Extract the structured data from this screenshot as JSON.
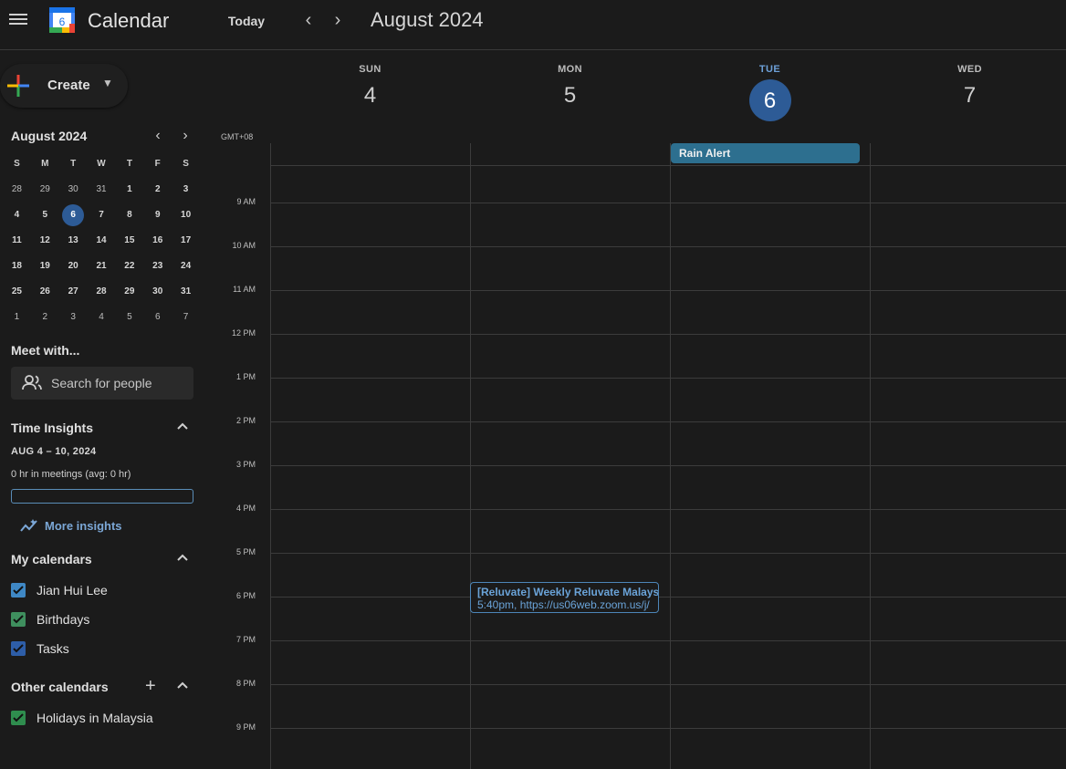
{
  "app": {
    "title": "Calendar",
    "logo_day": "6"
  },
  "header": {
    "today_label": "Today",
    "prev_icon": "chevron-left",
    "next_icon": "chevron-right",
    "month": "August 2024"
  },
  "create": {
    "label": "Create"
  },
  "mini_calendar": {
    "title": "August 2024",
    "weekdays": [
      "S",
      "M",
      "T",
      "W",
      "T",
      "F",
      "S"
    ],
    "weeks": [
      [
        "28",
        "29",
        "30",
        "31",
        "1",
        "2",
        "3"
      ],
      [
        "4",
        "5",
        "6",
        "7",
        "8",
        "9",
        "10"
      ],
      [
        "11",
        "12",
        "13",
        "14",
        "15",
        "16",
        "17"
      ],
      [
        "18",
        "19",
        "20",
        "21",
        "22",
        "23",
        "24"
      ],
      [
        "25",
        "26",
        "27",
        "28",
        "29",
        "30",
        "31"
      ],
      [
        "1",
        "2",
        "3",
        "4",
        "5",
        "6",
        "7"
      ]
    ],
    "today": "6"
  },
  "meet": {
    "title": "Meet with...",
    "placeholder": "Search for people"
  },
  "insights": {
    "title": "Time Insights",
    "range": "AUG 4 – 10, 2024",
    "meetings": "0 hr in meetings (avg: 0 hr)",
    "more": "More insights"
  },
  "my_calendars": {
    "title": "My calendars",
    "items": [
      {
        "label": "Jian Hui Lee",
        "color": "#3f88c5"
      },
      {
        "label": "Birthdays",
        "color": "#3f8f5e"
      },
      {
        "label": "Tasks",
        "color": "#2e5ea8"
      }
    ]
  },
  "other_calendars": {
    "title": "Other calendars",
    "items": [
      {
        "label": "Holidays in Malaysia",
        "color": "#2f8d4e"
      }
    ]
  },
  "week": {
    "days": [
      {
        "name": "SUN",
        "num": "4"
      },
      {
        "name": "MON",
        "num": "5"
      },
      {
        "name": "TUE",
        "num": "6",
        "today": true
      },
      {
        "name": "WED",
        "num": "7"
      }
    ],
    "timezone": "GMT+08",
    "times": [
      "9 AM",
      "10 AM",
      "11 AM",
      "12 PM",
      "1 PM",
      "2 PM",
      "3 PM",
      "4 PM",
      "5 PM",
      "6 PM",
      "7 PM",
      "8 PM",
      "9 PM"
    ]
  },
  "events": {
    "all_day": {
      "title": "Rain Alert",
      "color": "#2d6f8f"
    },
    "meeting": {
      "title": "[Reluvate] Weekly Reluvate Malaysia",
      "detail": "5:40pm, https://us06web.zoom.us/j/"
    }
  },
  "colors": {
    "accent": "#2d5b96",
    "today_text": "#6da0d8",
    "background": "#1b1b1b"
  }
}
